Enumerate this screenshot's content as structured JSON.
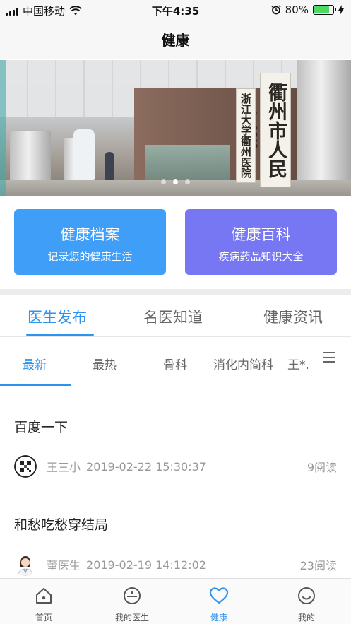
{
  "status_bar": {
    "carrier": "中国移动",
    "time": "下午4:35",
    "battery_percent": "80%",
    "battery_level": 0.8
  },
  "navbar": {
    "title": "健康"
  },
  "banner": {
    "sign_right": "衢州市人民医院",
    "sign_left": "浙江大学衢州医院",
    "slide_count": 3,
    "active_slide": 2
  },
  "quick_cards": [
    {
      "title": "健康档案",
      "subtitle": "记录您的健康生活",
      "color": "#3e9ef8"
    },
    {
      "title": "健康百科",
      "subtitle": "疾病药品知识大全",
      "color": "#7777f3"
    }
  ],
  "main_tabs": [
    "医生发布",
    "名医知道",
    "健康资讯"
  ],
  "active_main_tab": 0,
  "sub_tabs": [
    "最新",
    "最热",
    "骨科",
    "消化内简科",
    "王*."
  ],
  "active_sub_tab": 0,
  "articles": [
    {
      "title": "百度一下",
      "author": "王三小",
      "datetime": "2019-02-22 15:30:37",
      "reads": "9阅读"
    },
    {
      "title": "和愁吃愁穿结局",
      "author": "董医生",
      "datetime": "2019-02-19 14:12:02",
      "reads": "23阅读"
    }
  ],
  "tabbar": [
    {
      "label": "首页",
      "icon": "home-icon"
    },
    {
      "label": "我的医生",
      "icon": "doctor-bag-icon"
    },
    {
      "label": "健康",
      "icon": "heart-icon"
    },
    {
      "label": "我的",
      "icon": "smile-icon"
    }
  ],
  "active_tab": 2,
  "colors": {
    "accent": "#2d93f0",
    "card_blue": "#3e9ef8",
    "card_purple": "#7777f3",
    "battery": "#4cd964"
  }
}
